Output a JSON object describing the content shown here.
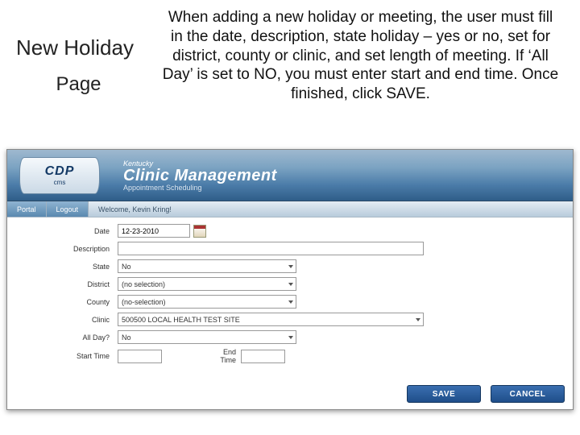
{
  "title": {
    "line1": "New Holiday",
    "line2": "Page"
  },
  "description": "When adding a new holiday or meeting, the user must fill in the date, description, state holiday – yes or no, set for district, county or clinic, and set length of meeting.  If ‘All Day’ is set to NO, you must enter start and end time.  Once finished, click SAVE.",
  "banner": {
    "logo_big": "CDP",
    "logo_small": "cms",
    "kentucky": "Kentucky",
    "title": "Clinic Management",
    "subtitle": "Appointment Scheduling"
  },
  "tabs": {
    "portal": "Portal",
    "logout": "Logout"
  },
  "welcome": "Welcome, Kevin Kring!",
  "form": {
    "labels": {
      "date": "Date",
      "description": "Description",
      "state": "State",
      "district": "District",
      "county": "County",
      "clinic": "Clinic",
      "allday": "All Day?",
      "start": "Start Time",
      "end": "End Time"
    },
    "values": {
      "date": "12-23-2010",
      "description": "",
      "state": "No",
      "district": "(no selection)",
      "county": "(no-selection)",
      "clinic": "500500    LOCAL HEALTH TEST SITE",
      "allday": "No",
      "start": "",
      "end": ""
    }
  },
  "buttons": {
    "save": "SAVE",
    "cancel": "CANCEL"
  }
}
